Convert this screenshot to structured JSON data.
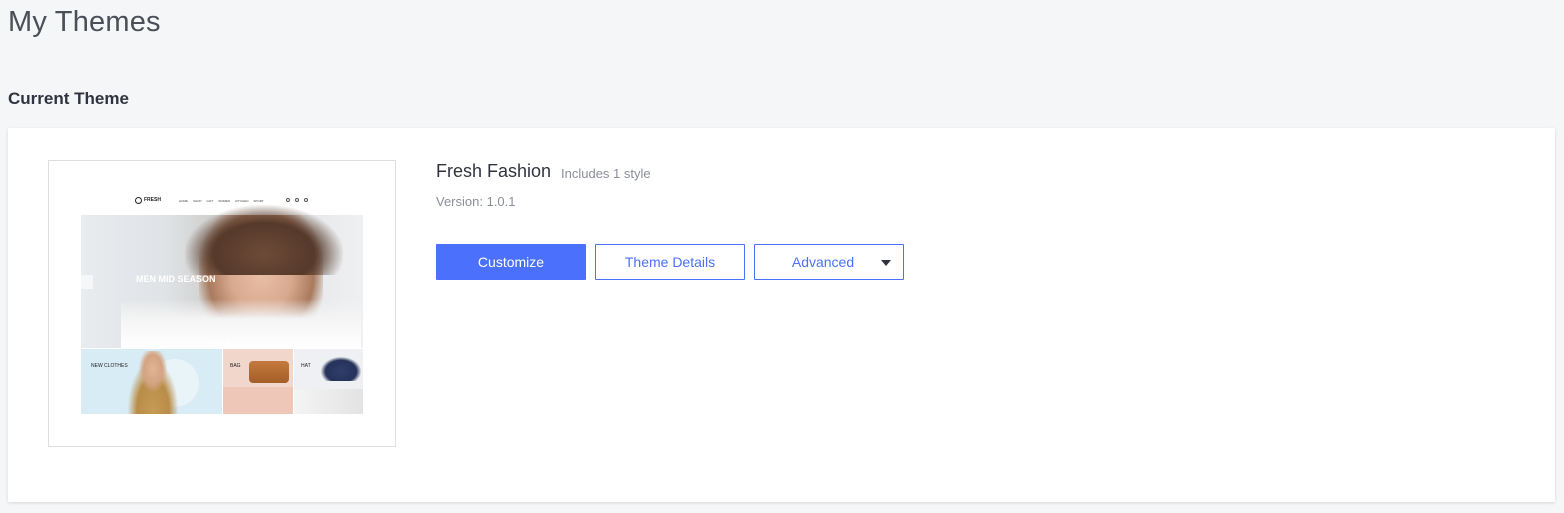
{
  "page": {
    "title": "My Themes"
  },
  "current_theme": {
    "section_title": "Current Theme",
    "name": "Fresh Fashion",
    "styles_note": "Includes 1 style",
    "version": "Version: 1.0.1",
    "actions": {
      "customize_label": "Customize",
      "details_label": "Theme Details",
      "advanced_label": "Advanced"
    },
    "preview": {
      "logo_text": "FRESH",
      "nav_links": [
        "HOME",
        "SHOP",
        "GIFT",
        "WOMEN",
        "KITCHEN",
        "SPORT"
      ],
      "hero_headline": "MEN MID SEASON",
      "tiles": [
        "NEW CLOTHES",
        "BAG",
        "HAT"
      ]
    }
  },
  "colors": {
    "background": "#f5f6f8",
    "accent": "#4b71fc",
    "text_primary": "#313440",
    "text_muted": "#8a8e97"
  }
}
